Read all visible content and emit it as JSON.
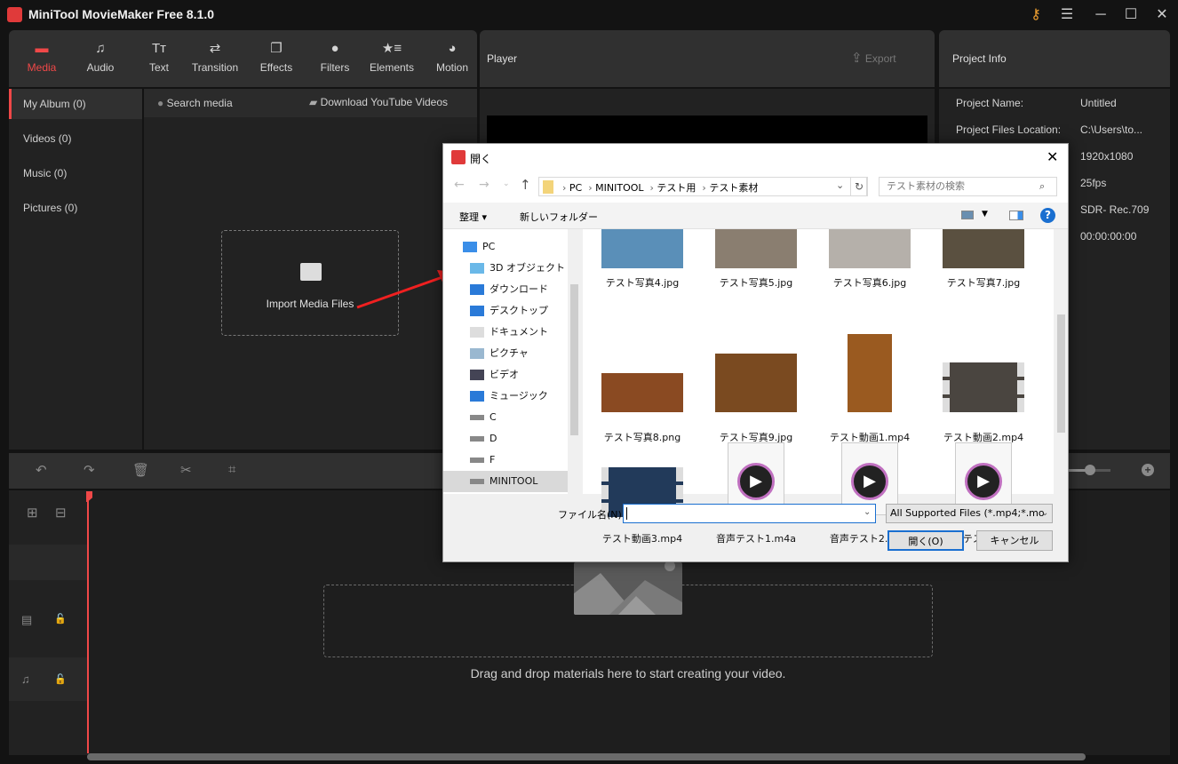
{
  "window": {
    "title": "MiniTool MovieMaker Free 8.1.0",
    "controls": [
      "key-icon",
      "menu-icon",
      "minimize-icon",
      "maximize-icon",
      "close-icon"
    ]
  },
  "toolbar": {
    "tabs": [
      {
        "label": "Media",
        "icon": "folder-icon",
        "active": true
      },
      {
        "label": "Audio",
        "icon": "music-icon"
      },
      {
        "label": "Text",
        "icon": "text-icon"
      },
      {
        "label": "Transition",
        "icon": "transition-icon"
      },
      {
        "label": "Effects",
        "icon": "effects-icon"
      },
      {
        "label": "Filters",
        "icon": "filters-icon"
      },
      {
        "label": "Elements",
        "icon": "elements-icon"
      },
      {
        "label": "Motion",
        "icon": "motion-icon"
      }
    ]
  },
  "player": {
    "title": "Player",
    "export_label": "Export"
  },
  "project_info": {
    "title": "Project Info",
    "rows": [
      {
        "key": "Project Name:",
        "value": "Untitled"
      },
      {
        "key": "Project Files Location:",
        "value": "C:\\Users\\to..."
      },
      {
        "key": "",
        "value": "1920x1080"
      },
      {
        "key": "",
        "value": "25fps"
      },
      {
        "key": "",
        "value": "SDR- Rec.709"
      },
      {
        "key": "",
        "value": "00:00:00:00"
      }
    ]
  },
  "sidebar": {
    "items": [
      {
        "label": "My Album (0)",
        "active": true
      },
      {
        "label": "Videos (0)"
      },
      {
        "label": "Music (0)"
      },
      {
        "label": "Pictures (0)"
      }
    ]
  },
  "media": {
    "search_placeholder": "Search media",
    "download_label": "Download YouTube Videos",
    "import_label": "Import Media Files"
  },
  "timeline": {
    "drop_text": "Drag and drop materials here to start creating your video."
  },
  "dialog": {
    "title": "開く",
    "breadcrumb": [
      "PC",
      "MINITOOL",
      "テスト用",
      "テスト素材"
    ],
    "search_placeholder": "テスト素材の検索",
    "organize_label": "整理 ▾",
    "new_folder_label": "新しいフォルダー",
    "nav": [
      {
        "label": "PC",
        "icon": "pc-icon"
      },
      {
        "label": "3D オブジェクト",
        "icon": "3d-objects-icon"
      },
      {
        "label": "ダウンロード",
        "icon": "download-icon"
      },
      {
        "label": "デスクトップ",
        "icon": "desktop-icon"
      },
      {
        "label": "ドキュメント",
        "icon": "document-icon"
      },
      {
        "label": "ピクチャ",
        "icon": "pictures-icon"
      },
      {
        "label": "ビデオ",
        "icon": "videos-icon"
      },
      {
        "label": "ミュージック",
        "icon": "music-icon"
      },
      {
        "label": "C",
        "icon": "drive-icon"
      },
      {
        "label": "D",
        "icon": "drive-icon"
      },
      {
        "label": "F",
        "icon": "drive-icon"
      },
      {
        "label": "MINITOOL",
        "icon": "drive-icon",
        "selected": true
      }
    ],
    "files": [
      {
        "name": "テスト写真4.jpg",
        "kind": "photo",
        "color": "#5a8fb8"
      },
      {
        "name": "テスト写真5.jpg",
        "kind": "photo",
        "color": "#8a7e70"
      },
      {
        "name": "テスト写真6.jpg",
        "kind": "photo",
        "color": "#b5b0aa"
      },
      {
        "name": "テスト写真7.jpg",
        "kind": "photo",
        "color": "#5a5040"
      },
      {
        "name": "テスト写真8.png",
        "kind": "photo",
        "color": "#8a4a22"
      },
      {
        "name": "テスト写真9.jpg",
        "kind": "photo",
        "color": "#7a4a20"
      },
      {
        "name": "テスト動画1.mp4",
        "kind": "video-portrait",
        "color": "#9a5a20"
      },
      {
        "name": "テスト動画2.mp4",
        "kind": "video",
        "color": "#4a4540"
      },
      {
        "name": "テスト動画3.mp4",
        "kind": "video",
        "color": "#223a5a"
      },
      {
        "name": "音声テスト1.m4a",
        "kind": "audio"
      },
      {
        "name": "音声テスト2.mp3",
        "kind": "audio"
      },
      {
        "name": "音声テスト3.mp3",
        "kind": "audio"
      }
    ],
    "filename_label": "ファイル名(N):",
    "filename_value": "",
    "filter_value": "All Supported Files (*.mp4;*.mo",
    "open_label": "開く(O)",
    "cancel_label": "キャンセル"
  },
  "colors": {
    "accent": "#f04848",
    "panel": "#303030",
    "background": "#131313"
  }
}
